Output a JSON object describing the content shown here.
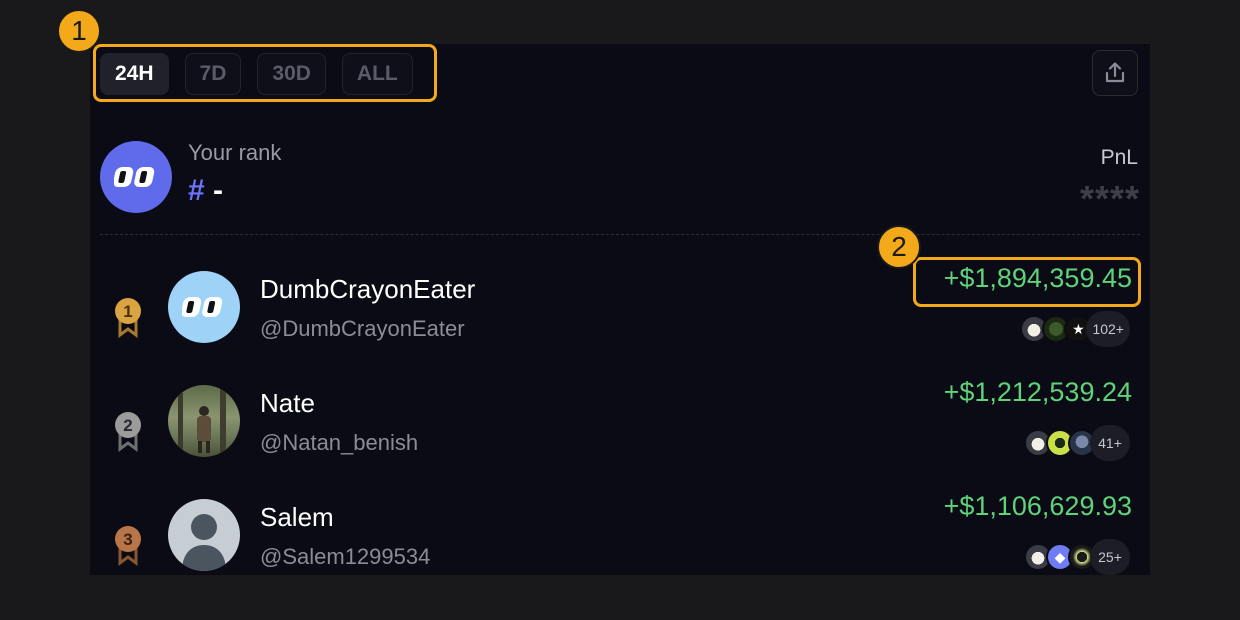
{
  "annotations": {
    "marker_1": "1",
    "marker_2": "2"
  },
  "tabs": [
    {
      "label": "24H",
      "active": true
    },
    {
      "label": "7D",
      "active": false
    },
    {
      "label": "30D",
      "active": false
    },
    {
      "label": "ALL",
      "active": false
    }
  ],
  "share_icon": "share-icon",
  "your_rank": {
    "label": "Your rank",
    "hash": "#",
    "value": "-"
  },
  "pnl": {
    "label": "PnL",
    "hidden_value": "****"
  },
  "leaderboard": [
    {
      "rank": "1",
      "name": "DumbCrayonEater",
      "handle": "@DumbCrayonEater",
      "pnl": "+$1,894,359.45",
      "tokens_more": "102+"
    },
    {
      "rank": "2",
      "name": "Nate",
      "handle": "@Natan_benish",
      "pnl": "+$1,212,539.24",
      "tokens_more": "41+"
    },
    {
      "rank": "3",
      "name": "Salem",
      "handle": "@Salem1299534",
      "pnl": "+$1,106,629.93",
      "tokens_more": "25+"
    }
  ],
  "colors": {
    "accent": "#6c74ff",
    "profit": "#5fd27a",
    "highlight": "#f4a91a",
    "gold": "#d9a441",
    "silver": "#9b9b9b",
    "bronze": "#b87648"
  }
}
